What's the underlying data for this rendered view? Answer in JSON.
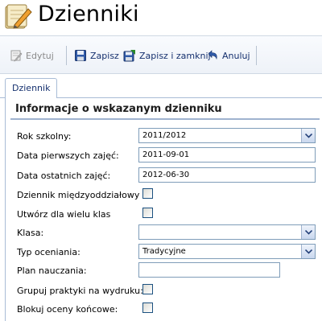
{
  "page": {
    "title": "Dzienniki",
    "app_icon": "notebook-pencil-icon"
  },
  "toolbar": {
    "edit_label": "Edytuj",
    "save_label": "Zapisz",
    "save_close_label": "Zapisz i zamknij",
    "cancel_label": "Anuluj"
  },
  "tabs": {
    "active": "Dziennik"
  },
  "section": {
    "title": "Informacje o wskazanym dzienniku"
  },
  "form": {
    "rok_szkolny": {
      "label": "Rok szkolny:",
      "value": "2011/2012"
    },
    "data_pierwszych": {
      "label": "Data pierwszych zajęć:",
      "value": "2011-09-01"
    },
    "data_ostatnich": {
      "label": "Data ostatnich zajęć:",
      "value": "2012-06-30"
    },
    "dziennik_miedzy": {
      "label": "Dziennik międzyoddziałowy",
      "checked": false
    },
    "utworz_wiele": {
      "label": "Utwórz dla wielu klas",
      "checked": false
    },
    "klasa": {
      "label": "Klasa:",
      "value": ""
    },
    "typ_oceniania": {
      "label": "Typ oceniania:",
      "value": "Tradycyjne"
    },
    "plan_nauczania": {
      "label": "Plan nauczania:",
      "value": ""
    },
    "grupuj_praktyki": {
      "label": "Grupuj praktyki na wydruku:",
      "checked": false
    },
    "blokuj_oceny": {
      "label": "Blokuj oceny końcowe:",
      "checked": false
    }
  },
  "colors": {
    "toolbar_text": "#15306e",
    "border": "#a9bcd6",
    "field_border": "#7f9db9"
  }
}
